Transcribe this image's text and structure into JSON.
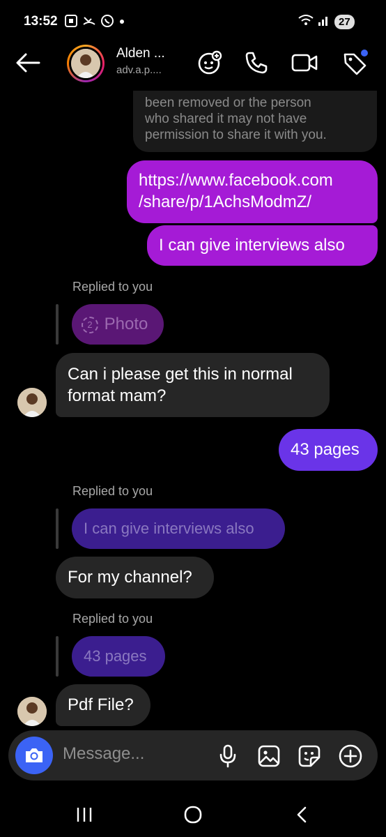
{
  "status": {
    "time": "13:52",
    "battery": "27",
    "icons": [
      "screenshot-icon",
      "missed-call-icon",
      "whatsapp-icon",
      "wifi-icon",
      "signal-icon",
      "battery-icon"
    ]
  },
  "header": {
    "name": "Alden ...",
    "username": "adv.a.p....",
    "actions": [
      "add-effect-icon",
      "phone-call-icon",
      "video-call-icon",
      "tag-icon"
    ]
  },
  "messages": {
    "m1": {
      "line1": "been removed or the person",
      "line2": "who shared it may not have",
      "line3": "permission to share it with you."
    },
    "m2": {
      "line1": "https://www.facebook.com",
      "line2": "/share/p/1AchsModmZ/"
    },
    "m3": {
      "text": "I can give interviews also"
    },
    "r1": {
      "label": "Replied to you",
      "quote": "Photo",
      "quote_badge": "2"
    },
    "m4": {
      "line1": "Can i please get this in normal",
      "line2": "format mam?"
    },
    "m5": {
      "text": "43 pages"
    },
    "r2": {
      "label": "Replied to you",
      "quote": "I can give interviews also"
    },
    "m6": {
      "text": "For my channel?"
    },
    "r3": {
      "label": "Replied to you",
      "quote": "43 pages"
    },
    "m7": {
      "text": "Pdf File?"
    }
  },
  "composer": {
    "placeholder": "Message...",
    "tools": [
      "microphone-icon",
      "gallery-icon",
      "sticker-icon",
      "plus-icon"
    ]
  },
  "colors": {
    "sent_bubble": "#a51bd6",
    "sent_bubble_latest": "#6a34e8",
    "received_bubble": "#262626",
    "camera_button": "#3b63f5"
  }
}
